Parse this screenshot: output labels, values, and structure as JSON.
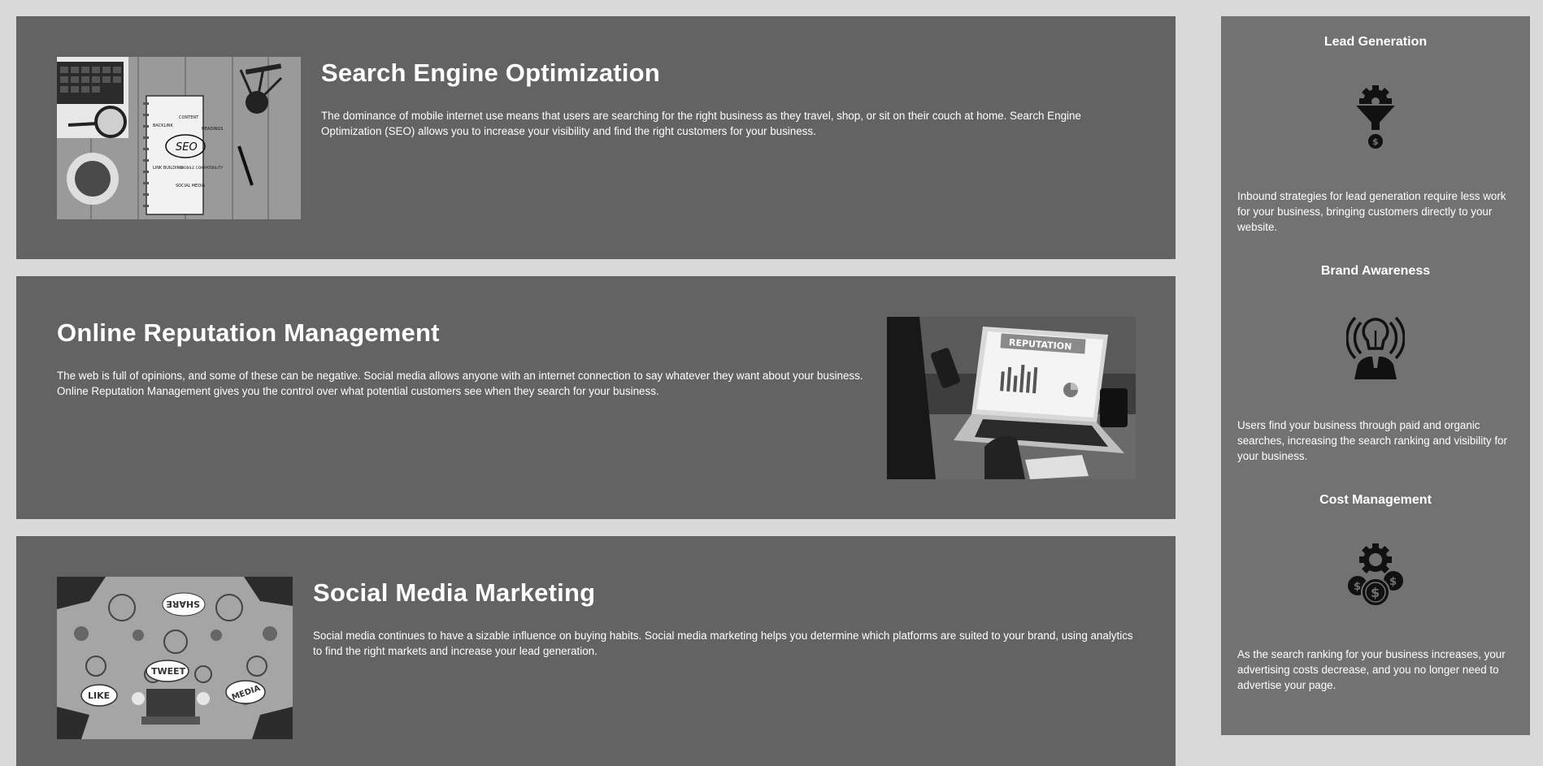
{
  "services": [
    {
      "title": "Search Engine Optimization",
      "text": "The dominance of mobile internet use means that users are searching for the right business as they travel, shop, or sit on their couch at home. Search Engine Optimization (SEO) allows you to increase your visibility and find the right customers for your business.",
      "image": {
        "icon": "seo-notebook-photo",
        "labels": [
          "SEO",
          "CONTENT",
          "HEADINGS",
          "BACKLINK",
          "LINK BUILDING",
          "MOBILE COMPATIBILITY",
          "SOCIAL MEDIA"
        ]
      }
    },
    {
      "title": "Online Reputation Management",
      "text": "The web is full of opinions, and some of these can be negative. Social media allows anyone with an internet connection to say whatever they want about your business. Online Reputation Management gives you the control over what potential customers see when they search for your business.",
      "image": {
        "icon": "reputation-laptop-photo",
        "labels": [
          "REPUTATION"
        ]
      }
    },
    {
      "title": "Social Media Marketing",
      "text": "Social media continues to have a sizable influence on buying habits. Social media marketing helps you determine which platforms are suited to your brand, using analytics to find the right markets and increase your lead generation.",
      "image": {
        "icon": "social-media-table-photo",
        "labels": [
          "SHARE",
          "TWEET",
          "LIKE",
          "MEDIA"
        ]
      }
    }
  ],
  "features": [
    {
      "title": "Lead Generation",
      "icon": "lead-funnel-icon",
      "text": "Inbound strategies for lead generation require less work for your business, bringing customers directly to your website."
    },
    {
      "title": "Brand Awareness",
      "icon": "lightbulb-person-icon",
      "text": "Users find your business through paid and organic searches, increasing the search ranking and visibility for your business."
    },
    {
      "title": "Cost Management",
      "icon": "gear-dollar-icon",
      "text": "As the search ranking for your business increases, your advertising costs decrease, and you no longer need to advertise your page."
    }
  ],
  "colors": {
    "page_background": "#d9d9d9",
    "card_background": "#636363",
    "sidebar_background": "#727272",
    "text": "#ffffff",
    "icon": "#111111"
  }
}
